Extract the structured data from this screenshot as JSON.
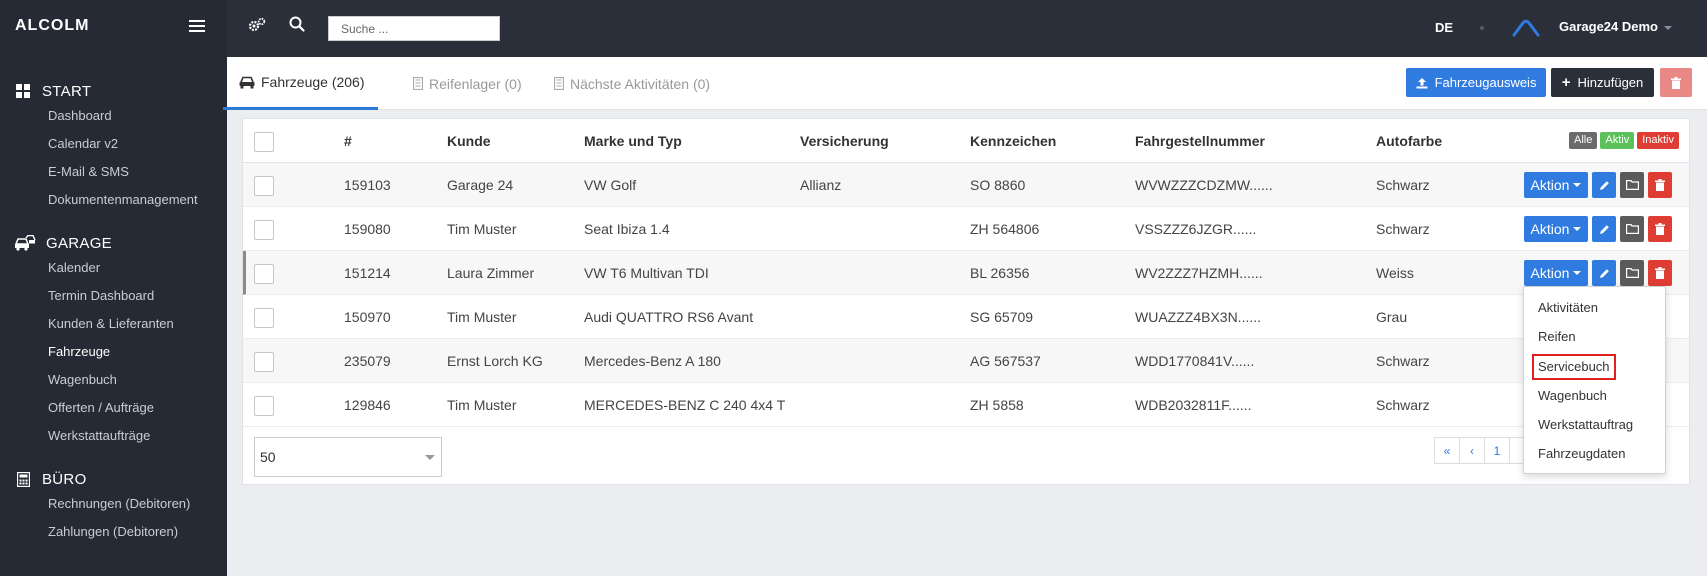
{
  "sidebar": {
    "brand": "ALCOLM",
    "sections": [
      {
        "title": "START",
        "items": [
          "Dashboard",
          "Calendar v2",
          "E-Mail & SMS",
          "Dokumentenmanagement"
        ]
      },
      {
        "title": "GARAGE",
        "items": [
          "Kalender",
          "Termin Dashboard",
          "Kunden & Lieferanten",
          "Fahrzeuge",
          "Wagenbuch",
          "Offerten / Aufträge",
          "Werkstattaufträge"
        ]
      },
      {
        "title": "BÜRO",
        "items": [
          "Rechnungen (Debitoren)",
          "Zahlungen (Debitoren)"
        ]
      }
    ],
    "active_item": "Fahrzeuge"
  },
  "topbar": {
    "search_placeholder": "Suche ...",
    "language": "DE",
    "user": "Garage24 Demo"
  },
  "tabs": [
    {
      "label": "Fahrzeuge (206)",
      "active": true
    },
    {
      "label": "Reifenlager (0)",
      "active": false
    },
    {
      "label": "Nächste Aktivitäten (0)",
      "active": false
    }
  ],
  "toolbar": {
    "vehicle_id_label": "Fahrzeugausweis",
    "add_label": "Hinzufügen"
  },
  "table": {
    "columns": [
      "#",
      "Kunde",
      "Marke und Typ",
      "Versicherung",
      "Kennzeichen",
      "Fahrgestellnummer",
      "Autofarbe"
    ],
    "filters": [
      "Alle",
      "Aktiv",
      "Inaktiv"
    ],
    "action_label": "Aktion",
    "rows": [
      {
        "id": "159103",
        "kunde": "Garage 24",
        "marke": "VW Golf",
        "versicherung": "Allianz",
        "kennzeichen": "SO 8860",
        "vin": "WVWZZZCDZMW......",
        "farbe": "Schwarz"
      },
      {
        "id": "159080",
        "kunde": "Tim Muster",
        "marke": "Seat Ibiza 1.4",
        "versicherung": "",
        "kennzeichen": "ZH 564806",
        "vin": "VSSZZZ6JZGR......",
        "farbe": "Schwarz"
      },
      {
        "id": "151214",
        "kunde": "Laura Zimmer",
        "marke": "VW T6 Multivan TDI",
        "versicherung": "",
        "kennzeichen": "BL 26356",
        "vin": "WV2ZZZ7HZMH......",
        "farbe": "Weiss"
      },
      {
        "id": "150970",
        "kunde": "Tim Muster",
        "marke": "Audi QUATTRO RS6 Avant",
        "versicherung": "",
        "kennzeichen": "SG 65709",
        "vin": "WUAZZZ4BX3N......",
        "farbe": "Grau"
      },
      {
        "id": "235079",
        "kunde": "Ernst Lorch KG",
        "marke": "Mercedes-Benz A 180",
        "versicherung": "",
        "kennzeichen": "AG 567537",
        "vin": "WDD1770841V......",
        "farbe": "Schwarz"
      },
      {
        "id": "129846",
        "kunde": "Tim Muster",
        "marke": "MERCEDES-BENZ C 240 4x4 T",
        "versicherung": "",
        "kennzeichen": "ZH 5858",
        "vin": "WDB2032811F......",
        "farbe": "Schwarz"
      }
    ]
  },
  "pagination": {
    "page_size": "50",
    "first": "«",
    "prev": "‹",
    "current": "1"
  },
  "dropdown": {
    "items": [
      "Aktivitäten",
      "Reifen",
      "Servicebuch",
      "Wagenbuch",
      "Werkstattauftrag",
      "Fahrzeugdaten"
    ],
    "highlighted": "Servicebuch"
  }
}
